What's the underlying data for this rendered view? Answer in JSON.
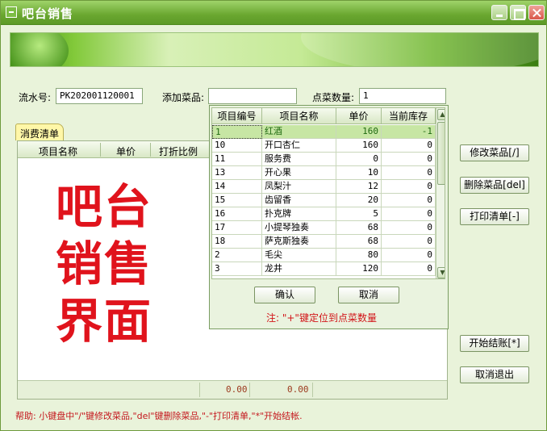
{
  "window": {
    "title": "吧台销售"
  },
  "form": {
    "serial_label": "流水号:",
    "serial_value": "PK202001120001",
    "add_item_label": "添加菜品:",
    "add_item_value": "",
    "quantity_label": "点菜数量:",
    "quantity_value": "1"
  },
  "order_list": {
    "tab_label": "消费清单",
    "columns": [
      "项目名称",
      "单价",
      "打折比例"
    ],
    "totals": [
      "0.00",
      "0.00"
    ],
    "watermark": [
      "吧台",
      "销售",
      "界面"
    ]
  },
  "dropdown": {
    "columns": [
      "项目编号",
      "项目名称",
      "单价",
      "当前库存"
    ],
    "rows": [
      {
        "code": "1",
        "name": "红酒",
        "price": "160",
        "stock": "-1",
        "selected": true
      },
      {
        "code": "10",
        "name": "开口杏仁",
        "price": "160",
        "stock": "0"
      },
      {
        "code": "11",
        "name": "服务费",
        "price": "0",
        "stock": "0"
      },
      {
        "code": "13",
        "name": "开心果",
        "price": "10",
        "stock": "0"
      },
      {
        "code": "14",
        "name": "凤梨汁",
        "price": "12",
        "stock": "0"
      },
      {
        "code": "15",
        "name": "齿留香",
        "price": "20",
        "stock": "0"
      },
      {
        "code": "16",
        "name": "扑克牌",
        "price": "5",
        "stock": "0"
      },
      {
        "code": "17",
        "name": "小提琴独奏",
        "price": "68",
        "stock": "0"
      },
      {
        "code": "18",
        "name": "萨克斯独奏",
        "price": "68",
        "stock": "0"
      },
      {
        "code": "2",
        "name": "毛尖",
        "price": "80",
        "stock": "0"
      },
      {
        "code": "3",
        "name": "龙井",
        "price": "120",
        "stock": "0"
      }
    ],
    "confirm_label": "确认",
    "cancel_label": "取消",
    "note": "注: \"+\"键定位到点菜数量"
  },
  "side_buttons": {
    "modify": "修改菜品[/]",
    "delete": "删除菜品[del]",
    "print": "打印清单[-]",
    "checkout": "开始结账[*]",
    "exit": "取消退出"
  },
  "help": "帮助: 小键盘中\"/\"键修改菜品,\"del\"键删除菜品,\"-\"打印清单,\"*\"开始结帐."
}
